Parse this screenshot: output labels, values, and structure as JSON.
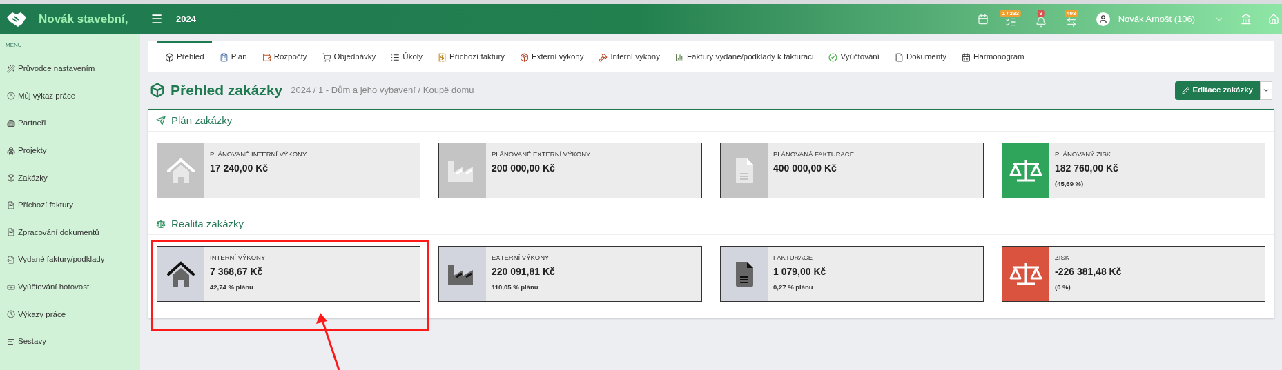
{
  "topbar": {
    "brand": "Novák stavební,",
    "menu_glyph": "☰",
    "year": "2024",
    "badges": [
      {
        "kind": "tasks",
        "count": "1 / 333",
        "color": "#f0a030"
      },
      {
        "kind": "bell",
        "count": "9",
        "color": "#d9534f"
      },
      {
        "kind": "transfer",
        "count": "403",
        "color": "#f0a030"
      }
    ],
    "user": "Novák Arnošt (106)"
  },
  "sidebar": {
    "heading": "MENU",
    "items": [
      {
        "label": "Průvodce nastavením",
        "kind": "wand"
      },
      {
        "label": "Můj výkaz práce",
        "kind": "clock"
      },
      {
        "label": "Partneři",
        "kind": "building"
      },
      {
        "label": "Projekty",
        "kind": "cubes"
      },
      {
        "label": "Zakázky",
        "kind": "cube"
      },
      {
        "label": "Příchozí faktury",
        "kind": "doc"
      },
      {
        "label": "Zpracování dokumentů",
        "kind": "doc"
      },
      {
        "label": "Vydané faktury/podklady",
        "kind": "export"
      },
      {
        "label": "Vyúčtování hotovosti",
        "kind": "money"
      },
      {
        "label": "Výkazy práce",
        "kind": "clock"
      },
      {
        "label": "Sestavy",
        "kind": "list"
      }
    ]
  },
  "tabs": [
    {
      "label": "Přehled",
      "kind": "cube",
      "selected": true
    },
    {
      "label": "Plán",
      "kind": "plan",
      "selected": false
    },
    {
      "label": "Rozpočty",
      "kind": "budget",
      "selected": false
    },
    {
      "label": "Objednávky",
      "kind": "order",
      "selected": false
    },
    {
      "label": "Úkoly",
      "kind": "list",
      "selected": false
    },
    {
      "label": "Příchozí faktury",
      "kind": "invoice",
      "selected": false
    },
    {
      "label": "Externí výkony",
      "kind": "ext",
      "selected": false
    },
    {
      "label": "Interní výkony",
      "kind": "int",
      "selected": false
    },
    {
      "label": "Faktury vydané/podklady k fakturaci",
      "kind": "chart",
      "selected": false
    },
    {
      "label": "Vyúčtování",
      "kind": "check",
      "selected": false
    },
    {
      "label": "Dokumenty",
      "kind": "file",
      "selected": false
    },
    {
      "label": "Harmonogram",
      "kind": "calendar",
      "selected": false
    }
  ],
  "page": {
    "title": "Přehled zakázky",
    "breadcrumb": "2024 / 1 - Dům a jeho vybavení / Koupě domu",
    "edit_button": "Editace zakázky"
  },
  "sections": [
    {
      "title": "Plán zakázky",
      "kind": "plane",
      "cards": [
        {
          "label": "PLÁNOVANÉ INTERNÍ VÝKONY",
          "value": "17 240,00 Kč",
          "kind": "house",
          "color": "#c4c4c4"
        },
        {
          "label": "PLÁNOVANÉ EXTERNÍ VÝKONY",
          "value": "200 000,00 Kč",
          "kind": "factory",
          "color": "#c4c4c4"
        },
        {
          "label": "PLÁNOVANÁ FAKTURACE",
          "value": "400 000,00 Kč",
          "kind": "file",
          "color": "#c4c4c4"
        },
        {
          "label": "PLÁNOVANÝ ZISK",
          "value": "182 760,00 Kč",
          "note": "(45,69 %)",
          "kind": "scale",
          "color": "#2ea55a"
        }
      ]
    },
    {
      "title": "Realita zakázky",
      "kind": "scale",
      "cards": [
        {
          "label": "INTERNÍ VÝKONY",
          "value": "7 368,67 Kč",
          "note": "42,74 % plánu",
          "kind": "house",
          "color": "#d2d5de"
        },
        {
          "label": "EXTERNÍ VÝKONY",
          "value": "220 091,81 Kč",
          "note": "110,05 % plánu",
          "kind": "factory",
          "color": "#d2d5de"
        },
        {
          "label": "FAKTURACE",
          "value": "1 079,00 Kč",
          "note": "0,27 % plánu",
          "kind": "file",
          "color": "#d2d5de"
        },
        {
          "label": "ZISK",
          "value": "-226 381,48 Kč",
          "note": "(0 %)",
          "kind": "scale",
          "color": "#d9533f"
        }
      ]
    }
  ]
}
